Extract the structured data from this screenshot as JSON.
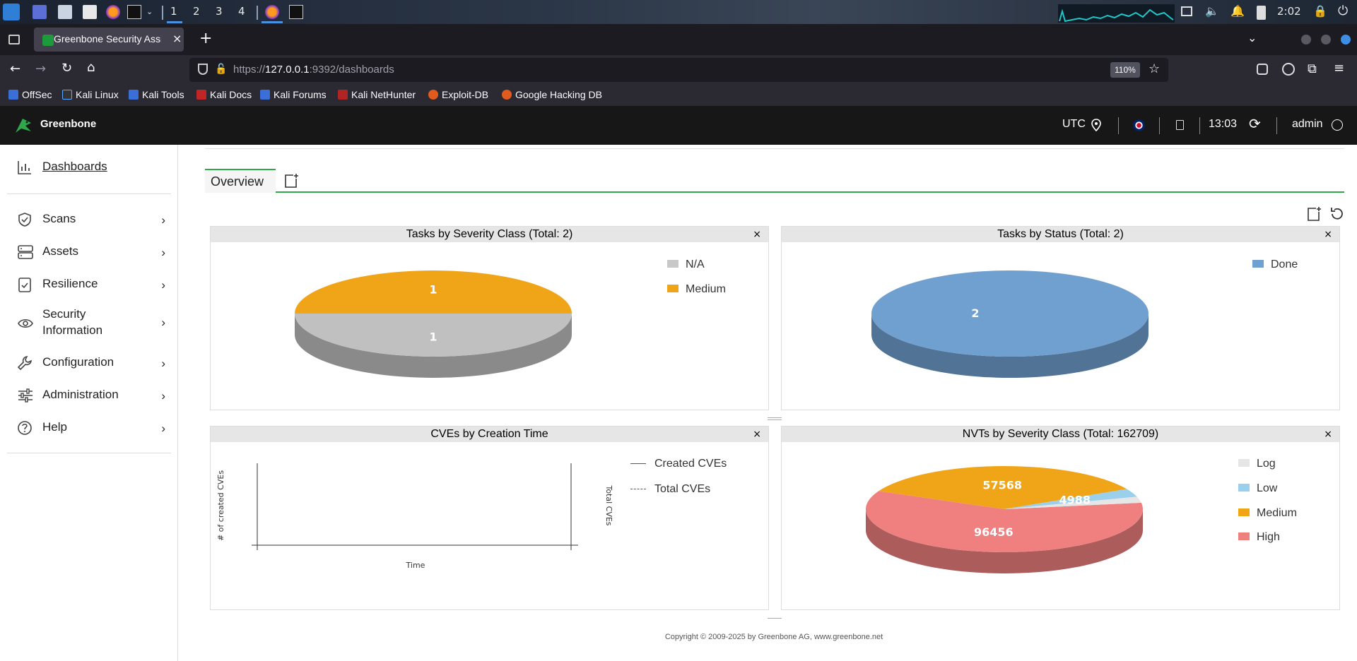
{
  "taskbar": {
    "workspaces": [
      "1",
      "2",
      "3",
      "4"
    ],
    "clock": "2:02"
  },
  "browser": {
    "tab_title": "Greenbone Security Assis",
    "url_prefix": "https://",
    "url_host": "127.0.0.1",
    "url_rest": ":9392/dashboards",
    "zoom": "110%",
    "bookmarks": [
      "OffSec",
      "Kali Linux",
      "Kali Tools",
      "Kali Docs",
      "Kali Forums",
      "Kali NetHunter",
      "Exploit-DB",
      "Google Hacking DB"
    ]
  },
  "header": {
    "brand": "Greenbone",
    "timezone": "UTC",
    "time": "13:03",
    "user": "admin"
  },
  "sidebar": {
    "items": [
      {
        "label": "Dashboards",
        "icon": "bar-chart-icon"
      },
      {
        "label": "Scans",
        "icon": "shield-icon"
      },
      {
        "label": "Assets",
        "icon": "server-icon"
      },
      {
        "label": "Resilience",
        "icon": "clipboard-check-icon"
      },
      {
        "label": "Security",
        "label2": "Information",
        "icon": "eye-icon"
      },
      {
        "label": "Configuration",
        "icon": "wrench-icon"
      },
      {
        "label": "Administration",
        "icon": "sliders-icon"
      },
      {
        "label": "Help",
        "icon": "help-circle-icon"
      }
    ]
  },
  "dashboard": {
    "tab_label": "Overview",
    "close_glyph": "×",
    "footer": "Copyright © 2009-2025 by Greenbone AG, www.greenbone.net"
  },
  "chart_data": [
    {
      "type": "pie",
      "title": "Tasks by Severity Class (Total: 2)",
      "categories": [
        "N/A",
        "Medium"
      ],
      "values": [
        1,
        1
      ],
      "colors": {
        "N/A": "#c0c0c0",
        "Medium": "#f0a519"
      },
      "legend": "right"
    },
    {
      "type": "pie",
      "title": "Tasks by Status (Total: 2)",
      "categories": [
        "Done"
      ],
      "values": [
        2
      ],
      "colors": {
        "Done": "#70a0d0"
      },
      "legend": "right"
    },
    {
      "type": "line",
      "title": "CVEs by Creation Time",
      "xlabel": "Time",
      "ylabel": "# of created CVEs",
      "y2label": "Total CVEs",
      "series": [
        {
          "name": "Created CVEs",
          "values": []
        },
        {
          "name": "Total CVEs",
          "values": []
        }
      ],
      "legend": "right"
    },
    {
      "type": "pie",
      "title": "NVTs by Severity Class (Total: 162709)",
      "categories": [
        "Log",
        "Low",
        "Medium",
        "High"
      ],
      "values": [
        3697,
        4988,
        57568,
        96456
      ],
      "value_labels": {
        "Low": "4988",
        "Medium": "57568",
        "High": "96456"
      },
      "colors": {
        "Log": "#e6e6e6",
        "Low": "#9ad0ec",
        "Medium": "#f0a519",
        "High": "#f08080"
      },
      "legend": "right"
    }
  ]
}
